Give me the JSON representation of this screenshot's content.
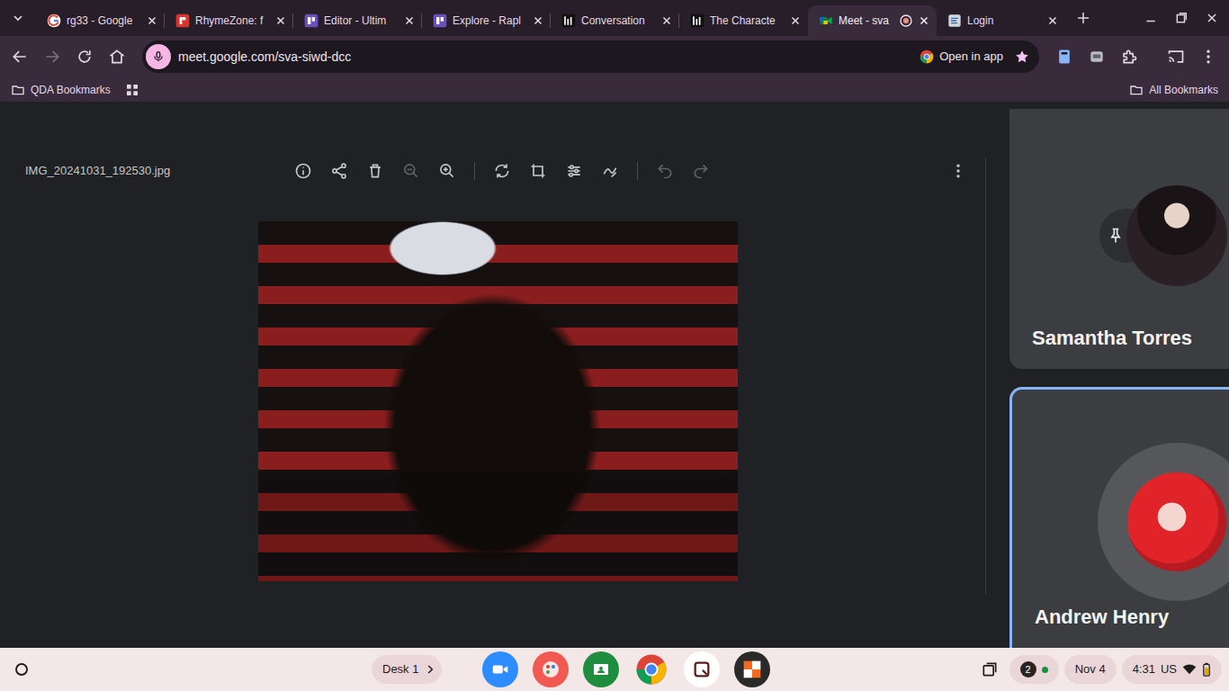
{
  "tabs": [
    {
      "label": "rg33 - Google",
      "selected": false,
      "recording": false
    },
    {
      "label": "RhymeZone: f",
      "selected": false,
      "recording": false
    },
    {
      "label": "Editor - Ultim",
      "selected": false,
      "recording": false
    },
    {
      "label": "Explore - Rapl",
      "selected": false,
      "recording": false
    },
    {
      "label": "Conversation",
      "selected": false,
      "recording": false
    },
    {
      "label": "The Characte",
      "selected": false,
      "recording": false
    },
    {
      "label": "Meet - sva",
      "selected": true,
      "recording": true
    },
    {
      "label": "Login",
      "selected": false,
      "recording": false
    }
  ],
  "address": {
    "url": "meet.google.com/sva-siwd-dcc",
    "open_in_app": "Open in app",
    "starred": true
  },
  "bookmarks": {
    "items": [
      "QDA Bookmarks"
    ],
    "all": "All Bookmarks"
  },
  "viewer": {
    "filename": "IMG_20241031_192530.jpg",
    "tools": [
      {
        "kind": "info",
        "disabled": false
      },
      {
        "kind": "share",
        "disabled": false
      },
      {
        "kind": "delete",
        "disabled": false
      },
      {
        "kind": "zoom-out",
        "disabled": true
      },
      {
        "kind": "zoom-in",
        "disabled": false
      },
      {
        "kind": "separator",
        "disabled": false
      },
      {
        "kind": "rotate",
        "disabled": false
      },
      {
        "kind": "crop",
        "disabled": false
      },
      {
        "kind": "adjust",
        "disabled": false
      },
      {
        "kind": "markup",
        "disabled": false
      },
      {
        "kind": "separator",
        "disabled": false
      },
      {
        "kind": "undo",
        "disabled": true
      },
      {
        "kind": "redo",
        "disabled": true
      }
    ]
  },
  "participants": [
    {
      "name": "Samantha Torres",
      "pinned": true,
      "speaking": false
    },
    {
      "name": "Andrew Henry",
      "pinned": false,
      "speaking": true
    }
  ],
  "shelf": {
    "desk": "Desk 1",
    "notifications": "2",
    "date": "Nov 4",
    "time": "4:31",
    "locale": "US"
  }
}
